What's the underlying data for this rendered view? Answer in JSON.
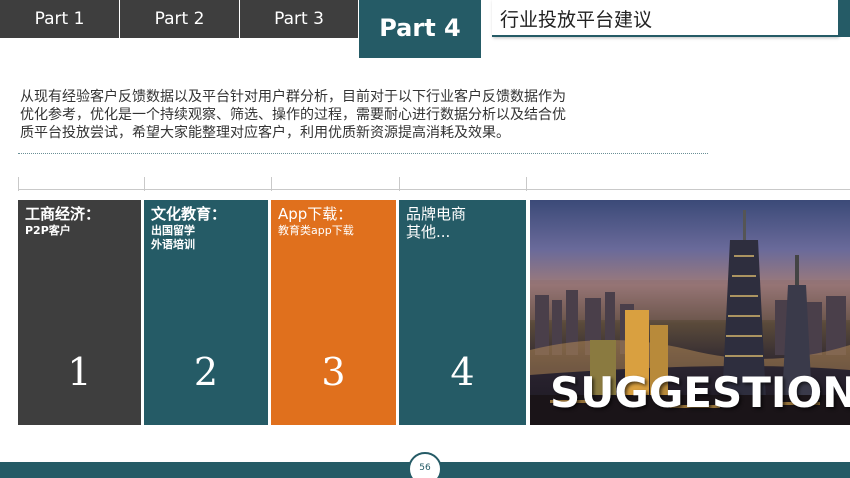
{
  "tabs": [
    {
      "label": "Part 1"
    },
    {
      "label": "Part 2"
    },
    {
      "label": "Part 3"
    },
    {
      "label": "Part 4",
      "active": true
    }
  ],
  "section_title": "行业投放平台建议",
  "intro": {
    "line1": "从现有经验客户反馈数据以及平台针对用户群分析，目前对于以下行业客户反馈数据作为",
    "line2": "优化参考，优化是一个持续观察、筛选、操作的过程，需要耐心进行数据分析以及结合优",
    "line3": "质平台投放尝试，希望大家能整理对应客户，利用优质新资源提高消耗及效果。"
  },
  "cards": [
    {
      "title": "工商经济：",
      "sub1": "P2P客户",
      "sub2": "",
      "number": "1",
      "color": "#3e3e3e"
    },
    {
      "title": "文化教育：",
      "sub1": "出国留学",
      "sub2": "外语培训",
      "number": "2",
      "color": "#255b66"
    },
    {
      "title": "App下载：",
      "sub1": "教育类app下载",
      "sub2": "",
      "number": "3",
      "color": "#e0701d"
    },
    {
      "title": "品牌电商",
      "sub1": "其他...",
      "sub2": "",
      "number": "4",
      "color": "#255b66"
    }
  ],
  "photo": {
    "overlay_text": "SUGGESTION"
  },
  "footer": {
    "page_number": "56"
  },
  "colors": {
    "dark": "#3e3e3e",
    "teal": "#255b66",
    "orange": "#e0701d"
  }
}
